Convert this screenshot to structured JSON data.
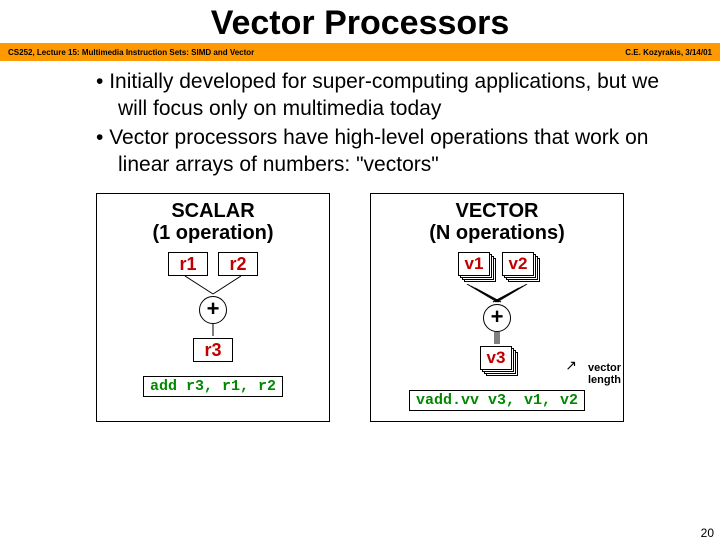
{
  "title": "Vector Processors",
  "bar": {
    "left": "CS252, Lecture 15: Multimedia Instruction Sets: SIMD and Vector",
    "right": "C.E. Kozyrakis, 3/14/01"
  },
  "bullets": [
    "Initially developed for super-computing applications, but we will focus only on multimedia today",
    "Vector processors have high-level operations that work on linear arrays of numbers: \"vectors\""
  ],
  "scalar": {
    "heading_l1": "SCALAR",
    "heading_l2": "(1 operation)",
    "r1": "r1",
    "r2": "r2",
    "r3": "r3",
    "op": "+",
    "instr": "add r3, r1, r2"
  },
  "vector": {
    "heading_l1": "VECTOR",
    "heading_l2": "(N operations)",
    "v1": "v1",
    "v2": "v2",
    "v3": "v3",
    "op": "+",
    "annot_l1": "vector",
    "annot_l2": "length",
    "instr": "vadd.vv v3, v1, v2"
  },
  "page_number": "20"
}
